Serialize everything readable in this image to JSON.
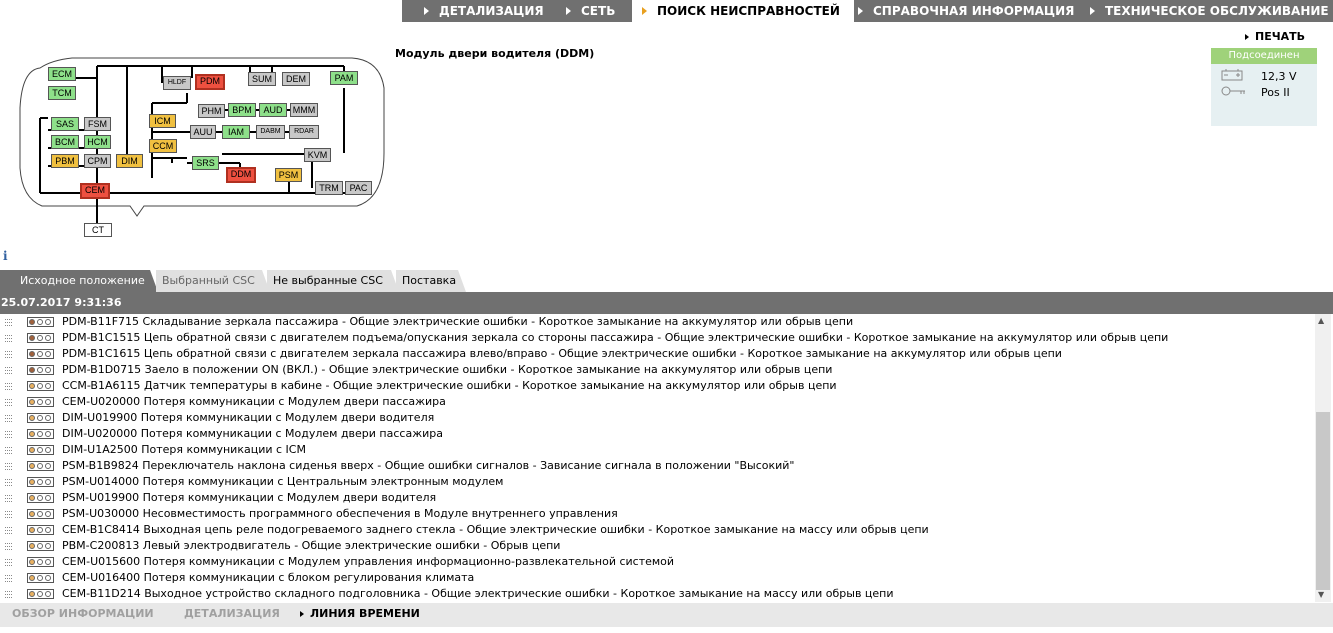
{
  "topnav": {
    "items": [
      {
        "label": "ДЕТАЛИЗАЦИЯ",
        "active": false
      },
      {
        "label": "СЕТЬ",
        "active": false
      },
      {
        "label": "ПОИСК НЕИСПРАВНОСТЕЙ",
        "active": true
      },
      {
        "label": "СПРАВОЧНАЯ ИНФОРМАЦИЯ",
        "active": false
      },
      {
        "label": "ТЕХНИЧЕСКОЕ ОБСЛУЖИВАНИЕ",
        "active": false
      }
    ]
  },
  "print_label": "ПЕЧАТЬ",
  "module_title": "Модуль двери водителя (DDM)",
  "connection": {
    "status": "Подсоединен",
    "voltage": "12,3 V",
    "ignition": "Pos II",
    "status_color": "#9fd27a"
  },
  "diagram": {
    "nodes": {
      "ECM": "ECM",
      "TCM": "TCM",
      "SAS": "SAS",
      "FSM": "FSM",
      "BCM": "BCM",
      "HCM": "HCM",
      "PBM": "PBM",
      "CPM": "CPM",
      "DIM": "DIM",
      "CEM": "CEM",
      "CT": "CT",
      "HLDF": "HLDF",
      "PDM": "PDM",
      "SUM": "SUM",
      "DEM": "DEM",
      "PAM": "PAM",
      "PHM": "PHM",
      "BPM": "BPM",
      "AUD": "AUD",
      "MMM": "MMM",
      "ICM": "ICM",
      "AUU": "AUU",
      "IAM": "IAM",
      "DABM": "DABM",
      "RDAR": "RDAR",
      "CCM": "CCM",
      "KVM": "KVM",
      "SRS": "SRS",
      "DDM": "DDM",
      "PSM": "PSM",
      "TRM": "TRM",
      "PAC": "PAC"
    },
    "status_colors": {
      "ok": "#8ee08a",
      "no_response": "#c8c8c8",
      "warning": "#f0c040",
      "fault": "#ee5040"
    }
  },
  "tabs": [
    {
      "label": "Исходное положение",
      "active": true
    },
    {
      "label": "Выбранный CSC",
      "active": false
    },
    {
      "label": "Не выбранные CSC",
      "active": false
    },
    {
      "label": "Поставка",
      "active": false
    }
  ],
  "timestamp": "25.07.2017 9:31:36",
  "dtc_list": [
    {
      "text": "PDM-B11F715 Складывание зеркала пассажира - Общие электрические ошибки - Короткое замыкание на аккумулятор или обрыв цепи",
      "leds": [
        "on",
        "off",
        "off"
      ]
    },
    {
      "text": "PDM-B1C1515 Цепь обратной связи с двигателем подъема/опускания зеркала со стороны пассажира - Общие электрические ошибки - Короткое замыкание на аккумулятор или обрыв цепи",
      "leds": [
        "on",
        "off",
        "off"
      ]
    },
    {
      "text": "PDM-B1C1615 Цепь обратной связи с двигателем зеркала пассажира влево/вправо - Общие электрические ошибки - Короткое замыкание на аккумулятор или обрыв цепи",
      "leds": [
        "on",
        "off",
        "off"
      ]
    },
    {
      "text": "PDM-B1D0715 Заело в положении ON (ВКЛ.) - Общие электрические ошибки - Короткое замыкание на аккумулятор или обрыв цепи",
      "leds": [
        "on",
        "off",
        "off"
      ]
    },
    {
      "text": "CCM-B1A6115 Датчик температуры в кабине - Общие электрические ошибки - Короткое замыкание на аккумулятор или обрыв цепи",
      "leds": [
        "amber",
        "off",
        "off"
      ]
    },
    {
      "text": "CEM-U020000 Потеря коммуникации с Модулем двери пассажира",
      "leds": [
        "amber",
        "off",
        "off"
      ]
    },
    {
      "text": "DIM-U019900 Потеря коммуникации с Модулем двери водителя",
      "leds": [
        "amber",
        "off",
        "off"
      ]
    },
    {
      "text": "DIM-U020000 Потеря коммуникации с Модулем двери пассажира",
      "leds": [
        "amber",
        "off",
        "off"
      ]
    },
    {
      "text": "DIM-U1A2500 Потеря коммуникации с ICM",
      "leds": [
        "amber",
        "off",
        "off"
      ]
    },
    {
      "text": "PSM-B1B9824 Переключатель наклона сиденья вверх - Общие ошибки сигналов - Зависание сигнала в положении \"Высокий\"",
      "leds": [
        "amber",
        "off",
        "off"
      ]
    },
    {
      "text": "PSM-U014000 Потеря коммуникации с Центральным электронным модулем",
      "leds": [
        "amber",
        "off",
        "off"
      ]
    },
    {
      "text": "PSM-U019900 Потеря коммуникации с Модулем двери водителя",
      "leds": [
        "amber",
        "off",
        "off"
      ]
    },
    {
      "text": "PSM-U030000 Несовместимость программного обеспечения в Модуле внутреннего управления",
      "leds": [
        "amber",
        "off",
        "off"
      ]
    },
    {
      "text": "CEM-B1C8414 Выходная цепь реле подогреваемого заднего стекла - Общие электрические ошибки - Короткое замыкание на массу или обрыв цепи",
      "leds": [
        "amber",
        "off",
        "off"
      ]
    },
    {
      "text": "PBM-C200813 Левый электродвигатель - Общие электрические ошибки - Обрыв цепи",
      "leds": [
        "amber",
        "off",
        "off"
      ]
    },
    {
      "text": "CEM-U015600 Потеря коммуникации с Модулем управления информационно-развлекательной системой",
      "leds": [
        "amber",
        "off",
        "off"
      ]
    },
    {
      "text": "CEM-U016400 Потеря коммуникации с блоком регулирования климата",
      "leds": [
        "amber",
        "off",
        "off"
      ]
    },
    {
      "text": "CEM-B11D214 Выходное устройство складного подголовника - Общие электрические ошибки - Короткое замыкание на массу или обрыв цепи",
      "leds": [
        "amber",
        "off",
        "off"
      ]
    }
  ],
  "bottombar": [
    {
      "label": "ОБЗОР ИНФОРМАЦИИ",
      "active": false
    },
    {
      "label": "ДЕТАЛИЗАЦИЯ",
      "active": false
    },
    {
      "label": "ЛИНИЯ ВРЕМЕНИ",
      "active": true
    }
  ]
}
